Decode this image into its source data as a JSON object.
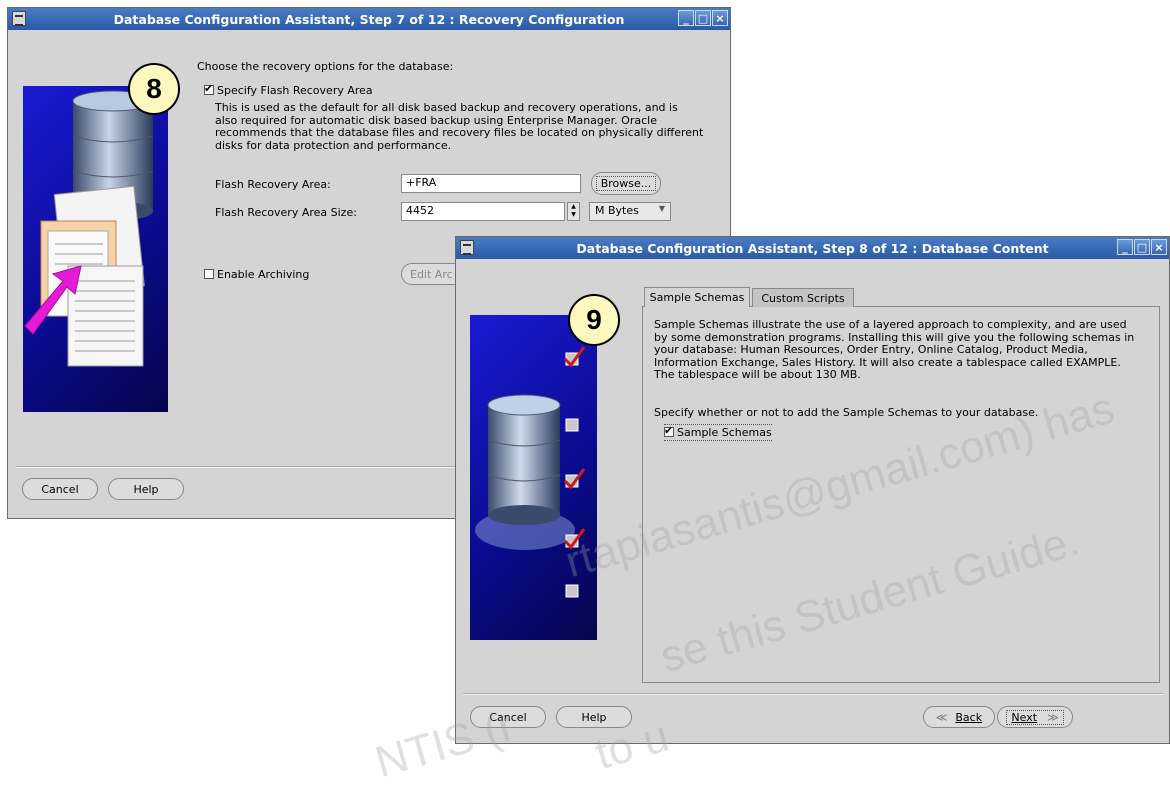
{
  "window_step7": {
    "title": "Database Configuration Assistant, Step 7 of 12 : Recovery Configuration",
    "badge": "8",
    "intro": "Choose the recovery options for the database:",
    "flash_checkbox_label": "Specify Flash Recovery Area",
    "description_lines": [
      "This is used as the default for all disk based backup and recovery operations, and is",
      "also required for automatic disk based backup using Enterprise Manager. Oracle",
      "recommends that the database files and recovery files be located on physically different",
      "disks for data protection and performance."
    ],
    "flash_area_label": "Flash Recovery Area:",
    "flash_area_value": "+FRA",
    "browse_label": "Browse...",
    "flash_size_label": "Flash Recovery Area Size:",
    "flash_size_value": "4452",
    "size_unit": "M Bytes",
    "archiving_label": "Enable Archiving",
    "edit_archive_label": "Edit Arc",
    "cancel_label": "Cancel",
    "help_label": "Help"
  },
  "window_step8": {
    "title": "Database Configuration Assistant, Step 8 of 12 : Database Content",
    "badge": "9",
    "tabs": [
      "Sample Schemas",
      "Custom Scripts"
    ],
    "description_lines": [
      "Sample Schemas illustrate the use of a layered approach to complexity, and are used",
      "by some demonstration programs. Installing this will give you the following schemas in",
      "your database: Human Resources, Order Entry, Online Catalog, Product Media,",
      "Information Exchange, Sales History. It will also create a tablespace called EXAMPLE.",
      "The tablespace will be about 130 MB."
    ],
    "specify_text": "Specify whether or not to add the Sample Schemas to your database.",
    "sample_checkbox_label": "Sample Schemas",
    "cancel_label": "Cancel",
    "help_label": "Help",
    "back_label": "Back",
    "next_label": "Next"
  },
  "watermark": {
    "line1": "rtapiasantis@gmail.com) has",
    "line2": "se this Student Guide.",
    "line3": "NTIS (r",
    "line4": "to u"
  }
}
